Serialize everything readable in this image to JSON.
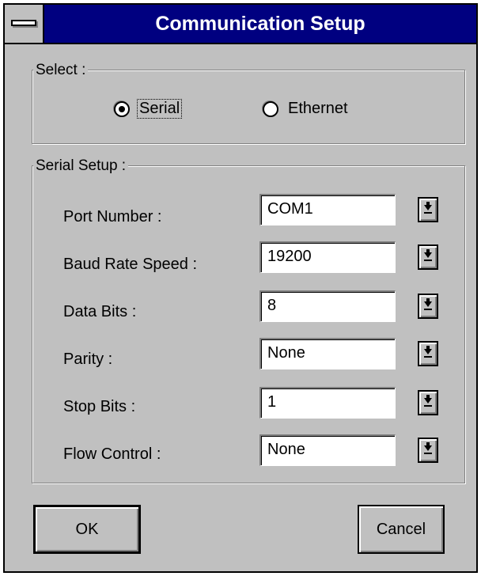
{
  "window": {
    "title": "Communication Setup"
  },
  "select_group": {
    "legend": "Select :",
    "options": [
      {
        "label": "Serial",
        "selected": true
      },
      {
        "label": "Ethernet",
        "selected": false
      }
    ]
  },
  "serial_group": {
    "legend": "Serial Setup :",
    "rows": [
      {
        "label": "Port Number :",
        "value": "COM1"
      },
      {
        "label": "Baud Rate Speed :",
        "value": "19200"
      },
      {
        "label": "Data Bits :",
        "value": "8"
      },
      {
        "label": "Parity :",
        "value": "None"
      },
      {
        "label": "Stop Bits :",
        "value": "1"
      },
      {
        "label": "Flow Control :",
        "value": "None"
      }
    ]
  },
  "buttons": {
    "ok_label": "OK",
    "cancel_label": "Cancel"
  },
  "icons": {
    "system_menu": "system-menu-icon",
    "dropdown": "chevron-down-icon"
  },
  "colors": {
    "titlebar": "#000080",
    "face": "#c0c0c0"
  }
}
